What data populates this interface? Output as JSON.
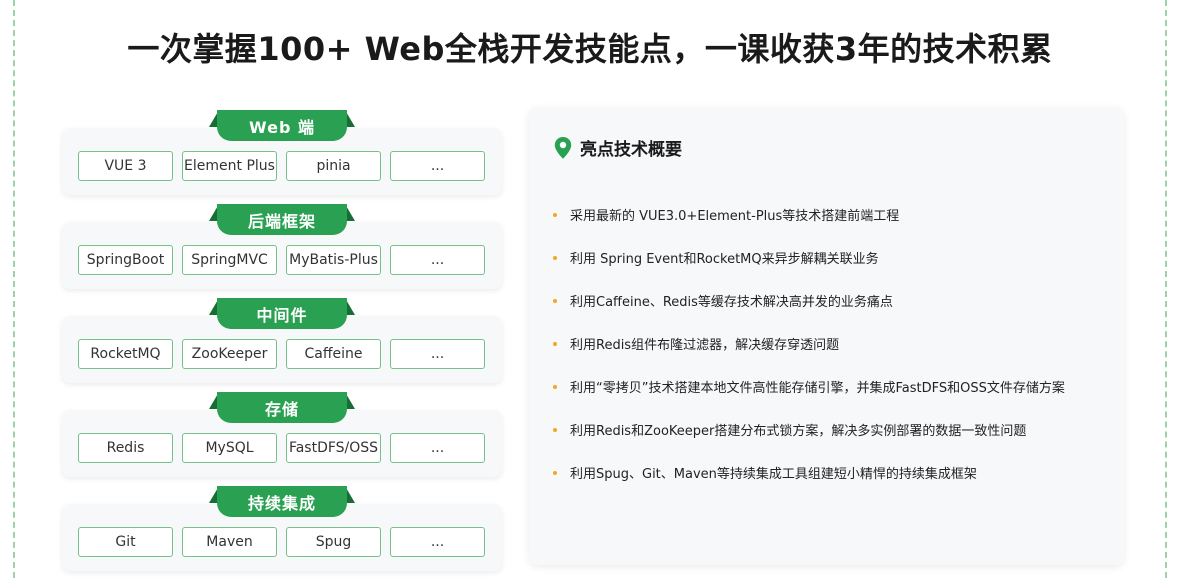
{
  "headline": "一次掌握100+ Web全栈开发技能点，一课收获3年的技术积累",
  "colors": {
    "accent_green": "#2aa152",
    "dark_green": "#176e34",
    "chip_border": "#77c08a",
    "bullet_dot": "#f5a623",
    "dashed_border": "#9bd3a6"
  },
  "groups": [
    {
      "label": "Web 端",
      "chips": [
        "VUE 3",
        "Element Plus",
        "pinia",
        "..."
      ]
    },
    {
      "label": "后端框架",
      "chips": [
        "SpringBoot",
        "SpringMVC",
        "MyBatis-Plus",
        "..."
      ]
    },
    {
      "label": "中间件",
      "chips": [
        "RocketMQ",
        "ZooKeeper",
        "Caffeine",
        "..."
      ]
    },
    {
      "label": "存储",
      "chips": [
        "Redis",
        "MySQL",
        "FastDFS/OSS",
        "..."
      ]
    },
    {
      "label": "持续集成",
      "chips": [
        "Git",
        "Maven",
        "Spug",
        "..."
      ]
    }
  ],
  "panel": {
    "icon": "location-pin-icon",
    "title": "亮点技术概要",
    "items": [
      "采用最新的 VUE3.0+Element-Plus等技术搭建前端工程",
      "利用 Spring Event和RocketMQ来异步解耦关联业务",
      "利用Caffeine、Redis等缓存技术解决高并发的业务痛点",
      "利用Redis组件布隆过滤器，解决缓存穿透问题",
      "利用“零拷贝”技术搭建本地文件高性能存储引擎，并集成FastDFS和OSS文件存储方案",
      "利用Redis和ZooKeeper搭建分布式锁方案，解决多实例部署的数据一致性问题",
      "利用Spug、Git、Maven等持续集成工具组建短小精悍的持续集成框架"
    ]
  }
}
